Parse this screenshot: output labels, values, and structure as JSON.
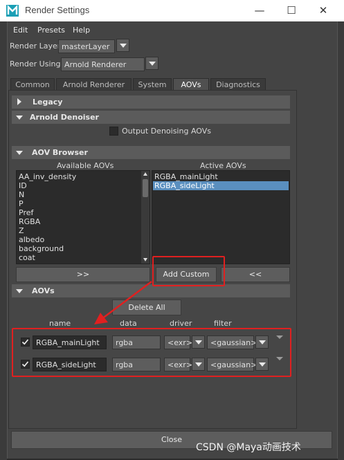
{
  "window": {
    "title": "Render Settings"
  },
  "menu": [
    "Edit",
    "Presets",
    "Help"
  ],
  "render_layer": {
    "label": "Render Layer",
    "value": "masterLayer"
  },
  "render_using": {
    "label": "Render Using",
    "value": "Arnold Renderer"
  },
  "tabs": [
    "Common",
    "Arnold Renderer",
    "System",
    "AOVs",
    "Diagnostics"
  ],
  "active_tab": "AOVs",
  "sections": {
    "legacy": "Legacy",
    "denoiser": "Arnold Denoiser",
    "browser": "AOV Browser",
    "aovs": "AOVs"
  },
  "denoiser": {
    "output_label": "Output Denoising AOVs",
    "checked": false
  },
  "browser": {
    "available_header": "Available AOVs",
    "active_header": "Active AOVs",
    "available": [
      "AA_inv_density",
      "ID",
      "N",
      "P",
      "Pref",
      "RGBA",
      "Z",
      "albedo",
      "background",
      "coat"
    ],
    "active": [
      "RGBA_mainLight",
      "RGBA_sideLight"
    ],
    "selected_active": "RGBA_sideLight",
    "add_button": ">>",
    "add_custom_button": "Add Custom",
    "remove_button": "<<"
  },
  "aovs": {
    "delete_all": "Delete All",
    "headers": {
      "name": "name",
      "data": "data",
      "driver": "driver",
      "filter": "filter"
    },
    "rows": [
      {
        "enabled": true,
        "name": "RGBA_mainLight",
        "data": "rgba",
        "driver": "<exr>",
        "filter": "<gaussian>"
      },
      {
        "enabled": true,
        "name": "RGBA_sideLight",
        "data": "rgba",
        "driver": "<exr>",
        "filter": "<gaussian>"
      }
    ]
  },
  "close_button": "Close",
  "watermark": "CSDN @Maya动画技术",
  "colors": {
    "highlight": "#5a8fbf",
    "annotation": "#e02020"
  }
}
